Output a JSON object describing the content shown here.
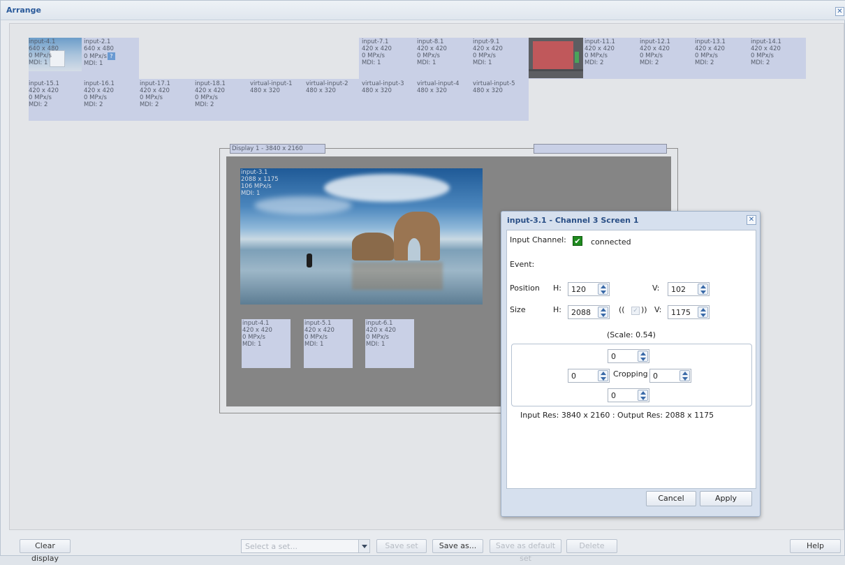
{
  "window": {
    "title": "Arrange",
    "close_glyph": "✕"
  },
  "inputs_row1": [
    {
      "name": "input-4.1",
      "res": "640 x 480",
      "rate": "0 MPx/s",
      "mdi": "MDI: 1"
    },
    {
      "name": "input-2.1",
      "res": "640 x 480",
      "rate": "0 MPx/s",
      "mdi": "MDI: 1",
      "help": "?"
    },
    {
      "name": "input-7.1",
      "res": "420 x 420",
      "rate": "0 MPx/s",
      "mdi": "MDI: 1"
    },
    {
      "name": "input-8.1",
      "res": "420 x 420",
      "rate": "0 MPx/s",
      "mdi": "MDI: 1"
    },
    {
      "name": "input-9.1",
      "res": "420 x 420",
      "rate": "0 MPx/s",
      "mdi": "MDI: 1"
    },
    {
      "name": "input-11.1",
      "res": "420 x 420",
      "rate": "0 MPx/s",
      "mdi": "MDI: 2"
    },
    {
      "name": "input-12.1",
      "res": "420 x 420",
      "rate": "0 MPx/s",
      "mdi": "MDI: 2"
    },
    {
      "name": "input-13.1",
      "res": "420 x 420",
      "rate": "0 MPx/s",
      "mdi": "MDI: 2"
    },
    {
      "name": "input-14.1",
      "res": "420 x 420",
      "rate": "0 MPx/s",
      "mdi": "MDI: 2"
    }
  ],
  "inputs_row2": [
    {
      "name": "input-15.1",
      "res": "420 x 420",
      "rate": "0 MPx/s",
      "mdi": "MDI: 2"
    },
    {
      "name": "input-16.1",
      "res": "420 x 420",
      "rate": "0 MPx/s",
      "mdi": "MDI: 2"
    },
    {
      "name": "input-17.1",
      "res": "420 x 420",
      "rate": "0 MPx/s",
      "mdi": "MDI: 2"
    },
    {
      "name": "input-18.1",
      "res": "420 x 420",
      "rate": "0 MPx/s",
      "mdi": "MDI: 2"
    },
    {
      "name": "virtual-input-1",
      "res": "480 x 320"
    },
    {
      "name": "virtual-input-2",
      "res": "480 x 320"
    },
    {
      "name": "virtual-input-3",
      "res": "480 x 320"
    },
    {
      "name": "virtual-input-4",
      "res": "480 x 320"
    },
    {
      "name": "virtual-input-5",
      "res": "480 x 320"
    }
  ],
  "display": {
    "tab_label": "Display 1 - 3840 x 2160",
    "main_input": {
      "name": "input-3.1",
      "res": "2088 x 1175",
      "rate": "106 MPx/s",
      "mdi": "MDI: 1"
    },
    "sub_inputs": [
      {
        "name": "input-4.1",
        "res": "420 x 420",
        "rate": "0 MPx/s",
        "mdi": "MDI: 1"
      },
      {
        "name": "input-5.1",
        "res": "420 x 420",
        "rate": "0 MPx/s",
        "mdi": "MDI: 1"
      },
      {
        "name": "input-6.1",
        "res": "420 x 420",
        "rate": "0 MPx/s",
        "mdi": "MDI: 1"
      }
    ]
  },
  "dialog": {
    "title": "input-3.1 - Channel 3 Screen 1",
    "input_channel_label": "Input Channel:",
    "check_glyph": "✔",
    "connected_text": "connected",
    "event_label": "Event:",
    "position_label": "Position",
    "size_label": "Size",
    "h_label": "H:",
    "v_label": "V:",
    "position_h": "120",
    "position_v": "102",
    "size_h": "2088",
    "size_v": "1175",
    "lock_open": "((",
    "lock_close": "))",
    "lock_glyph": "✓",
    "scale_text": "(Scale: 0.54)",
    "crop_top": "0",
    "crop_left": "0",
    "crop_right": "0",
    "crop_bottom": "0",
    "cropping_label": "Cropping",
    "res_info": "Input Res: 3840 x 2160 :  Output Res: 2088 x 1175",
    "cancel_label": "Cancel",
    "apply_label": "Apply"
  },
  "toolbar": {
    "clear_display": "Clear display",
    "select_placeholder": "Select a set...",
    "save_set": "Save set",
    "save_as": "Save as...",
    "save_default": "Save as default set",
    "delete": "Delete",
    "help": "Help"
  }
}
